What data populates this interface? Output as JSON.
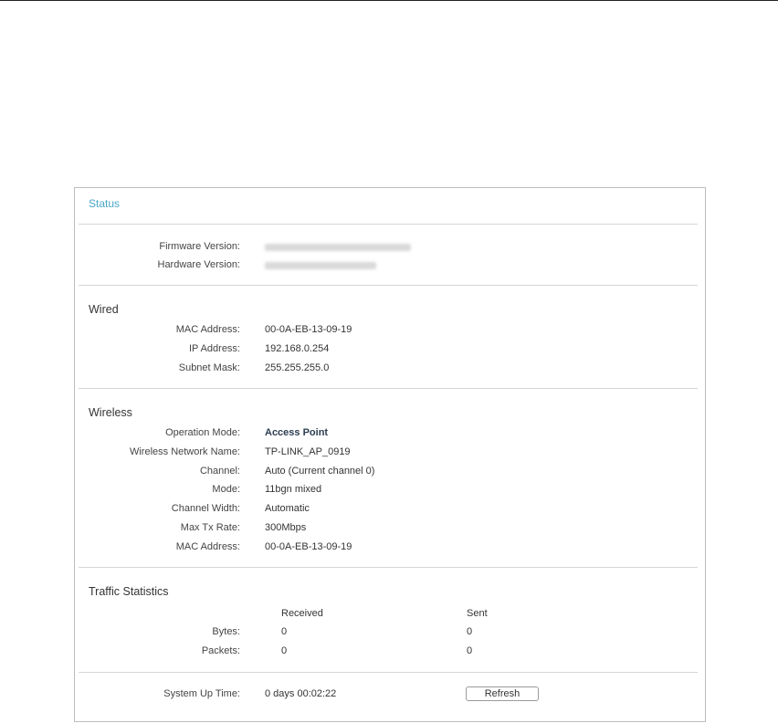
{
  "status": {
    "title": "Status",
    "firmware_label": "Firmware Version:",
    "hardware_label": "Hardware Version:"
  },
  "wired": {
    "title": "Wired",
    "rows": [
      {
        "label": "MAC Address:",
        "value": "00-0A-EB-13-09-19"
      },
      {
        "label": "IP Address:",
        "value": "192.168.0.254"
      },
      {
        "label": "Subnet Mask:",
        "value": "255.255.255.0"
      }
    ]
  },
  "wireless": {
    "title": "Wireless",
    "rows": [
      {
        "label": "Operation Mode:",
        "value": "Access Point"
      },
      {
        "label": "Wireless Network Name:",
        "value": "TP-LINK_AP_0919"
      },
      {
        "label": "Channel:",
        "value": "Auto (Current channel 0)"
      },
      {
        "label": "Mode:",
        "value": "11bgn mixed"
      },
      {
        "label": "Channel Width:",
        "value": "Automatic"
      },
      {
        "label": "Max Tx Rate:",
        "value": "300Mbps"
      },
      {
        "label": "MAC Address:",
        "value": "00-0A-EB-13-09-19"
      }
    ]
  },
  "traffic": {
    "title": "Traffic Statistics",
    "received_header": "Received",
    "sent_header": "Sent",
    "rows": [
      {
        "label": "Bytes:",
        "received": "0",
        "sent": "0"
      },
      {
        "label": "Packets:",
        "received": "0",
        "sent": "0"
      }
    ]
  },
  "uptime": {
    "label": "System Up Time:",
    "value": "0 days 00:02:22",
    "refresh_label": "Refresh"
  }
}
